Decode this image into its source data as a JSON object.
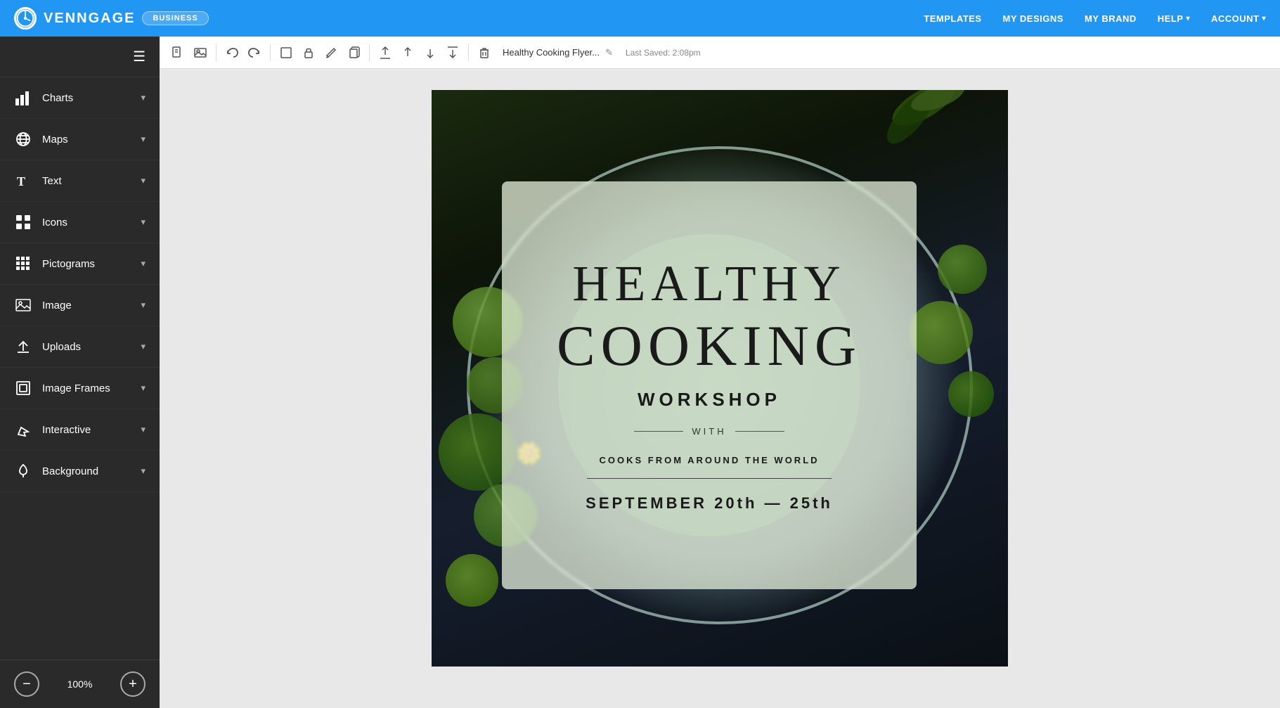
{
  "topNav": {
    "logoText": "VENNGAGE",
    "badgeLabel": "BUSINESS",
    "links": [
      {
        "id": "templates",
        "label": "TEMPLATES"
      },
      {
        "id": "my-designs",
        "label": "MY DESIGNS"
      },
      {
        "id": "my-brand",
        "label": "MY BRAND"
      },
      {
        "id": "help",
        "label": "HELP",
        "hasDropdown": true
      },
      {
        "id": "account",
        "label": "ACCOUNT",
        "hasDropdown": true
      }
    ]
  },
  "toolbar": {
    "title": "Healthy Cooking Flyer...",
    "saveStatus": "Last Saved: 2:08pm",
    "buttons": [
      {
        "id": "page-icon",
        "symbol": "🗂"
      },
      {
        "id": "image-icon",
        "symbol": "🖼"
      },
      {
        "id": "undo",
        "symbol": "↩"
      },
      {
        "id": "redo",
        "symbol": "↪"
      },
      {
        "id": "frame",
        "symbol": "▭"
      },
      {
        "id": "lock",
        "symbol": "🔒"
      },
      {
        "id": "edit",
        "symbol": "✎"
      },
      {
        "id": "copy",
        "symbol": "⊞"
      },
      {
        "id": "bring-forward-top",
        "symbol": "⤒"
      },
      {
        "id": "bring-forward",
        "symbol": "↑"
      },
      {
        "id": "send-backward",
        "symbol": "↓"
      },
      {
        "id": "send-backward-bottom",
        "symbol": "⤓"
      },
      {
        "id": "delete",
        "symbol": "🗑"
      }
    ]
  },
  "sidebar": {
    "items": [
      {
        "id": "charts",
        "label": "Charts",
        "icon": "chart"
      },
      {
        "id": "maps",
        "label": "Maps",
        "icon": "globe"
      },
      {
        "id": "text",
        "label": "Text",
        "icon": "text"
      },
      {
        "id": "icons",
        "label": "Icons",
        "icon": "icons"
      },
      {
        "id": "pictograms",
        "label": "Pictograms",
        "icon": "pictograms"
      },
      {
        "id": "image",
        "label": "Image",
        "icon": "image"
      },
      {
        "id": "uploads",
        "label": "Uploads",
        "icon": "upload"
      },
      {
        "id": "image-frames",
        "label": "Image Frames",
        "icon": "image-frames"
      },
      {
        "id": "interactive",
        "label": "Interactive",
        "icon": "interactive"
      },
      {
        "id": "background",
        "label": "Background",
        "icon": "background"
      }
    ],
    "zoomLevel": "100%",
    "zoomMinusLabel": "−",
    "zoomPlusLabel": "+"
  },
  "canvas": {
    "design": {
      "titleLine1": "HEALTHY",
      "titleLine2": "COOKING",
      "titleLine3": "WORKSHOP",
      "withText": "WITH",
      "subtitleText": "COOKS FROM AROUND THE WORLD",
      "dateText": "SEPTEMBER 20th — 25th"
    }
  },
  "colors": {
    "topNavBg": "#2196F3",
    "sidebarBg": "#2a2a2a",
    "canvasBg": "#e8e8e8",
    "toolbarBg": "#ffffff"
  }
}
